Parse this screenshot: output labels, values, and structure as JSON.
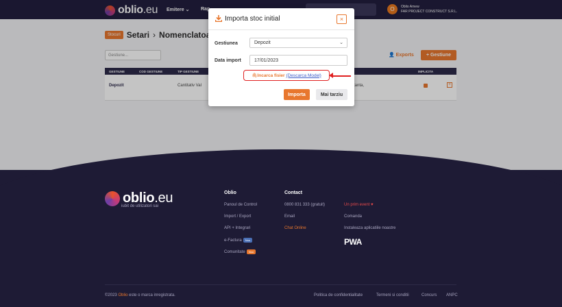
{
  "navbar": {
    "logo_main": "oblio",
    "logo_suffix": ".eu",
    "items": [
      "Emitere",
      "Rap"
    ],
    "user_initial": "O",
    "user_name": "Oblio Amew",
    "user_company": "FAR PROJECT CONSTRUCT S.R.L."
  },
  "page": {
    "breadcrumb_badge": "Stocuri",
    "breadcrumb_1": "Setari",
    "breadcrumb_2": "Nomenclatoare",
    "filter_placeholder": "Gestiune...",
    "exports_label": "Exports",
    "add_button_label": "+ Gestiune",
    "table_headers": [
      "GESTIUNE",
      "COD GESTIUNE",
      "TIP GESTIUNE",
      "IMPLICITA"
    ],
    "row": {
      "gestiune": "Depozit",
      "tip": "Cantitativ Val",
      "extra": "stanta,"
    }
  },
  "modal": {
    "title": "Importa stoc initial",
    "close_glyph": "×",
    "gestiunea_label": "Gestiunea",
    "gestiunea_value": "Depozit",
    "data_label": "Data import",
    "data_value": "17/01/2023",
    "upload_label": "Incarca fisier",
    "download_model_link": "(Descarca Model)",
    "import_button": "Importa",
    "later_button": "Mai tarziu"
  },
  "footer": {
    "tagline": "iubit de utilizatori sai",
    "col_oblio": {
      "heading": "Oblio",
      "links": [
        "Panoul de Control",
        "Import / Export",
        "API + Integrari",
        "e-Factura",
        "Comunitate"
      ],
      "badge_efactura": "Nou",
      "badge_comunitate": "Nou"
    },
    "col_contact": {
      "heading": "Contact",
      "phone": "0800 831 333 (gratuit)",
      "email": "Email",
      "chat": "Chat Online"
    },
    "col_extra": {
      "event": "Un prim event",
      "heart": "♥",
      "comanda": "Comanda",
      "install": "Instaleaza aplicatiile noastre",
      "pwa": "PWA"
    },
    "copyright_prefix": "©2023",
    "copyright_brand": "Oblio",
    "copyright_suffix": "este o marca inregistrata.",
    "bottom_links": [
      "Politica de confidentialitate",
      "Termeni si conditii",
      "Concurs",
      "ANPC"
    ]
  },
  "colors": {
    "accent": "#e8772e",
    "navy": "#231f3f",
    "highlight_red": "#e02020"
  }
}
